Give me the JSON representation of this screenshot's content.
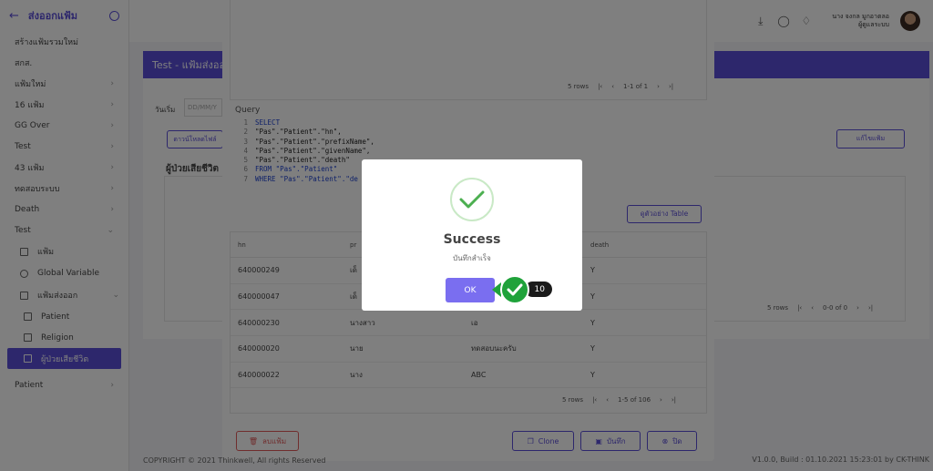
{
  "sidebar": {
    "back_icon": "arrow-left-icon",
    "title": "ส่งออกแฟ้ม",
    "items": [
      {
        "label": "สร้างแฟ้มรวมใหม่",
        "chevron": false
      },
      {
        "label": "สกส.",
        "chevron": false
      },
      {
        "label": "แฟ้มใหม่",
        "chevron": true
      },
      {
        "label": "16 แฟ้ม",
        "chevron": true
      },
      {
        "label": "GG Over",
        "chevron": true
      },
      {
        "label": "Test",
        "chevron": true
      },
      {
        "label": "43 แฟ้ม",
        "chevron": true
      },
      {
        "label": "ทดสอบระบบ",
        "chevron": true
      },
      {
        "label": "Death",
        "chevron": true
      },
      {
        "label": "Test",
        "chevron": true,
        "expanded": true
      }
    ],
    "sub_items": [
      {
        "label": "แฟ้ม",
        "icon": "folder-icon"
      },
      {
        "label": "Global Variable",
        "icon": "circle-icon"
      },
      {
        "label": "แฟ้มส่งออก",
        "icon": "edit-icon"
      }
    ],
    "sub_sub_items": [
      {
        "label": "Patient",
        "icon": "file-icon"
      },
      {
        "label": "Religion",
        "icon": "file-icon"
      },
      {
        "label": "ผู้ป่วยเสียชีวิต",
        "icon": "file-icon",
        "active": true
      }
    ],
    "last_item": {
      "label": "Patient"
    }
  },
  "topbar": {
    "user_name": "นาง จงกล มูกอาตลอ",
    "user_role": "ผู้ดูแลระบบ"
  },
  "content": {
    "banner_title": "Test - แฟ้มส่งออก",
    "date_label": "วันเริ่ม",
    "date_placeholder": "DD/MM/Y",
    "export_button": "ดาวน์โหลดไฟล์",
    "section_title": "ผู้ป่วยเสียชีวิต",
    "edit_button": "แก้ไขแฟ้ม",
    "rows_label": "5 rows",
    "range_label": "0-0 of 0"
  },
  "modal": {
    "top_pager": {
      "rows": "5 rows",
      "range": "1-1 of 1"
    },
    "query_label": "Query",
    "code_lines": [
      {
        "n": "1",
        "text": "SELECT",
        "kw": true
      },
      {
        "n": "2",
        "text": "\"Pas\".\"Patient\".\"hn\",",
        "kw": false
      },
      {
        "n": "3",
        "text": "\"Pas\".\"Patient\".\"prefixName\",",
        "kw": false
      },
      {
        "n": "4",
        "text": "\"Pas\".\"Patient\".\"givenName\",",
        "kw": false
      },
      {
        "n": "5",
        "text": "\"Pas\".\"Patient\".\"death\"",
        "kw": false
      },
      {
        "n": "6",
        "text": "FROM \"Pas\".\"Patient\"",
        "kw": true
      },
      {
        "n": "7",
        "text": "WHERE \"Pas\".\"Patient\".\"de",
        "kw": true
      }
    ],
    "sample_button": "ดูตัวอย่าง Table",
    "table": {
      "headers": [
        "hn",
        "pr",
        "",
        "death"
      ],
      "rows": [
        [
          "640000249",
          "เด็",
          "",
          "Y"
        ],
        [
          "640000047",
          "เด็",
          "",
          "Y"
        ],
        [
          "640000230",
          "นางสาว",
          "เอ",
          "Y"
        ],
        [
          "640000020",
          "นาย",
          "ทดสอบนะครับ",
          "Y"
        ],
        [
          "640000022",
          "นาง",
          "ABC",
          "Y"
        ]
      ],
      "pager": {
        "rows": "5 rows",
        "range": "1-5 of 106"
      }
    },
    "footer": {
      "delete": "ลบแฟ้ม",
      "clone": "Clone",
      "save": "บันทึก",
      "close": "ปิด"
    }
  },
  "dialog": {
    "title": "Success",
    "message": "บันทึกสำเร็จ",
    "ok": "OK"
  },
  "badge": {
    "count": "10"
  },
  "footer": {
    "copyright": "COPYRIGHT © 2021 Thinkwell, All rights Reserved",
    "version": "V1.0.0, Build : 01.10.2021 15:23:01 by CK-THINK"
  },
  "colors": {
    "accent": "#5b4ed8",
    "success": "#1fa23a",
    "danger": "#e05a5a"
  }
}
